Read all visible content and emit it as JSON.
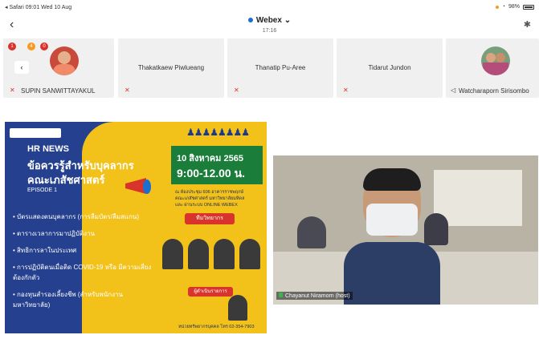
{
  "status_bar": {
    "left": "◂ Safari  09:01  Wed 10 Aug",
    "battery": "98%"
  },
  "header": {
    "title": "Webex",
    "time": "17:16"
  },
  "participants": [
    {
      "name": "SUPIN SANWITTAYAKUL"
    },
    {
      "name": "Thakatkaew Piwlueang"
    },
    {
      "name": "Thanatip Pu-Aree"
    },
    {
      "name": "Tidarut Jundon"
    },
    {
      "name": "Watcharaporn Sirisombo"
    }
  ],
  "badges": [
    "1",
    "4",
    "0"
  ],
  "slide": {
    "hr_news": "HR NEWS",
    "headline1": "ข้อควรรู้สำหรับบุคลากร",
    "headline2": "คณะเภสัชศาสตร์",
    "episode": "EPISODE 1",
    "date": "10 สิงหาคม 2565",
    "time": "9:00-12.00 น.",
    "venue1": "ณ ห้องประชุม 606 อาคารราชพฤกษ์",
    "venue2": "คณะเภสัชศาสตร์ มหาวิทยาลัยมหิดล",
    "venue3": "และ ผ่านระบบ ONLINE WEBEX",
    "speakers_label": "ทีมวิทยากร",
    "host_label": "ผู้ดำเนินรายการ",
    "bullets": [
      "บัตรแสดงตนบุคลากร (การลืมบัตร/ลืมสแกน)",
      "ตารางเวลาการมาปฏิบัติงาน",
      "สิทธิการลาในประเทศ",
      "การปฏิบัติตนเมื่อติด COVID-19 หรือ มีความเสี่ยงต้องกักตัว",
      "กองทุนสำรองเลี้ยงชีพ (สำหรับพนักงานมหาวิทยาลัย)"
    ],
    "footer": "หน่วยทรัพยากรบุคคล โทร 02-354-7903"
  },
  "video": {
    "caption": "Chayanut Niramorn (host)"
  }
}
